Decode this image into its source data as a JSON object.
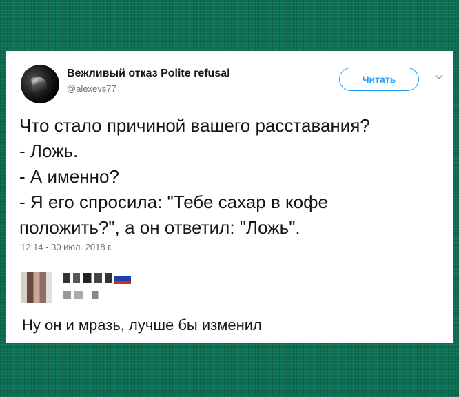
{
  "tweet": {
    "author_name": "Вежливый отказ Polite refusal",
    "author_handle": "@alexevs77",
    "follow_label": "Читать",
    "lines": [
      "Что стало причиной вашего расставания?",
      "- Ложь.",
      "- А именно?",
      "- Я его спросила: \"Тебе сахар в кофе",
      "положить?\", а он ответил: \"Ложь\"."
    ],
    "timestamp": "12:14 - 30 июл. 2018 г."
  },
  "reply": {
    "text": "Ну он и мразь, лучше бы изменил",
    "flag_colors": [
      "#ffffff",
      "#1c3fa8",
      "#d52b1e"
    ]
  },
  "icons": {
    "avatar": "avatar-photo",
    "more": "chevron-down-icon",
    "reply_avatar": "pixelated-avatar",
    "flag": "russian-flag-icon"
  },
  "colors": {
    "background": "#0c6e52",
    "accent": "#1da1f2",
    "text": "#14171a",
    "secondary_text": "#657786"
  }
}
